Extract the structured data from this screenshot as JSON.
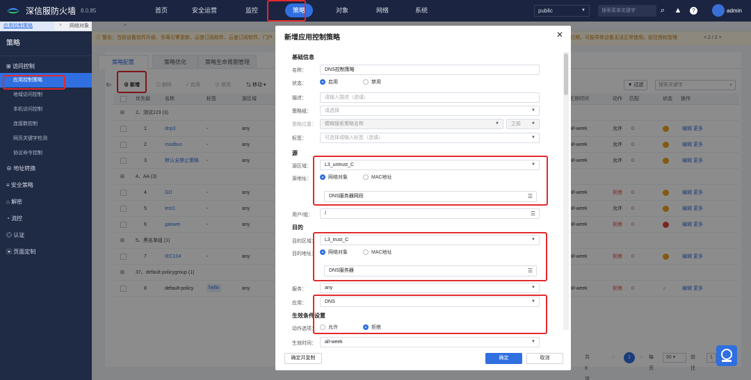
{
  "brand": {
    "name": "深信服防火墙",
    "version": "8.0.85"
  },
  "topnav": [
    "首页",
    "安全运营",
    "监控",
    "策略",
    "对象",
    "网络",
    "系统"
  ],
  "topnav_active": "策略",
  "topbar": {
    "scope": "public",
    "search_placeholder": "搜索菜单关键字",
    "user": "admin"
  },
  "page_tabs": [
    "应用控制策略",
    "网络对象"
  ],
  "sidebar": {
    "title": "策略",
    "group": "访问控制",
    "items": [
      "应用控制策略",
      "地域访问控制",
      "本机访问控制",
      "连接数控制",
      "网页关键字检测",
      "协议命令控制"
    ],
    "main_items": [
      "地址转换",
      "安全策略",
      "解密",
      "流控",
      "认证",
      "页面定制"
    ]
  },
  "notice": "警告：当前设备软件升级、杀毒引擎更新、云查订阅软件、云鉴订阅软件、门户…",
  "notice_right": "过期，可能导致设备无法正常使用。前往授权管理",
  "notice_page": "< 2 / 2 >",
  "content_tabs": [
    "策略配置",
    "策略优化",
    "策略生命周期管理"
  ],
  "toolbar": {
    "new": "新增",
    "delete": "删除",
    "enable": "启用",
    "disable": "禁用",
    "move": "移动",
    "filter": "过滤",
    "search_placeholder": "搜索关键字"
  },
  "table": {
    "headers": [
      "优先级",
      "名称",
      "标签",
      "源区域",
      "生效时间",
      "动作",
      "匹配",
      "状态",
      "操作"
    ],
    "rows": [
      {
        "group": "2、测试123 (3)"
      },
      {
        "priority": "1",
        "name": "dnp3",
        "tag": "-",
        "src": "any",
        "time": "all-week",
        "action": "允许",
        "match": "0",
        "status_color": "#f0a020",
        "ops": "编辑 更多"
      },
      {
        "priority": "2",
        "name": "modbus",
        "tag": "-",
        "src": "any",
        "time": "all-week",
        "action": "允许",
        "match": "0",
        "status_color": "#f0a020",
        "ops": "编辑 更多"
      },
      {
        "priority": "3",
        "name": "默认全禁止策略",
        "tag": "-",
        "src": "any",
        "time": "all-week",
        "action": "允许",
        "match": "0",
        "status_color": "#f0a020",
        "ops": "编辑 更多"
      },
      {
        "group": "4、AA (3)"
      },
      {
        "priority": "4",
        "name": "GD",
        "tag": "-",
        "src": "any",
        "time": "all-week",
        "action": "拒绝",
        "match": "0",
        "status_color": "#f0a020",
        "ops": "编辑 更多"
      },
      {
        "priority": "5",
        "name": "test1",
        "tag": "-",
        "src": "any",
        "time": "all-week",
        "action": "允许",
        "match": "0",
        "status_color": "#f0a020",
        "ops": "编辑 更多"
      },
      {
        "priority": "6",
        "name": "gaowei",
        "tag": "-",
        "src": "any",
        "time": "all-week",
        "action": "拒绝",
        "match": "0",
        "status_color": "#e0463c",
        "ops": "编辑 更多"
      },
      {
        "group": "5、黑名单组 (1)"
      },
      {
        "priority": "7",
        "name": "IEC104",
        "tag": "-",
        "src": "any",
        "time": "all-week",
        "action": "拒绝",
        "match": "0",
        "status_color": "#f0a020",
        "ops": "编辑 更多"
      },
      {
        "group": "37、default-policygroup (1)"
      },
      {
        "priority": "8",
        "name": "default-policy",
        "tag": "hello",
        "src": "any",
        "time": "all-week",
        "action": "拒绝",
        "match": "0",
        "status_color": "",
        "ops": "编辑 更多"
      }
    ]
  },
  "pager": {
    "total": "共 8 项",
    "page": "1",
    "per_page": "每页",
    "size": "50",
    "goto": "前往",
    "goto_page": "1"
  },
  "modal": {
    "title": "新增应用控制策略",
    "basic_title": "基础信息",
    "name_label": "名称：",
    "name_value": "DNS控制策略",
    "status_label": "状态：",
    "status_enable": "启用",
    "status_disable": "禁用",
    "desc_label": "描述：",
    "desc_placeholder": "请输入描述（选填）",
    "group_label": "策略组：",
    "group_placeholder": "请选择",
    "position_label": "策略位置：",
    "position_placeholder": "模糊搜索策略名称",
    "position_after": "之前",
    "tag_label": "标签：",
    "tag_placeholder": "可选择或输入标签（选填）",
    "src_title": "源",
    "src_zone_label": "源区域：",
    "src_zone_value": "L3_untrust_C",
    "src_addr_label": "源地址：",
    "radio_netobj": "网络对象",
    "radio_mac": "MAC地址",
    "src_addr_value": "DNS服务器网段",
    "user_label": "用户/组：",
    "user_value": "/",
    "dst_title": "目的",
    "dst_zone_label": "目的区域：",
    "dst_zone_value": "L3_trust_C",
    "dst_addr_label": "目的地址：",
    "dst_addr_value": "DNS服务器",
    "service_label": "服务：",
    "service_value": "any",
    "app_label": "应用：",
    "app_value": "DNS",
    "cond_title": "生效条件设置",
    "action_label": "动作选项：",
    "action_allow": "允许",
    "action_deny": "拒绝",
    "time_label": "生效时间：",
    "time_value": "all-week",
    "btn_confirm_copy": "确定并复制",
    "btn_ok": "确定",
    "btn_cancel": "取消"
  },
  "colors": {
    "accent": "#2f6fe0",
    "highlight": "#e2292c",
    "topbar": "#1b2440",
    "sidebar": "#1f2a44"
  }
}
